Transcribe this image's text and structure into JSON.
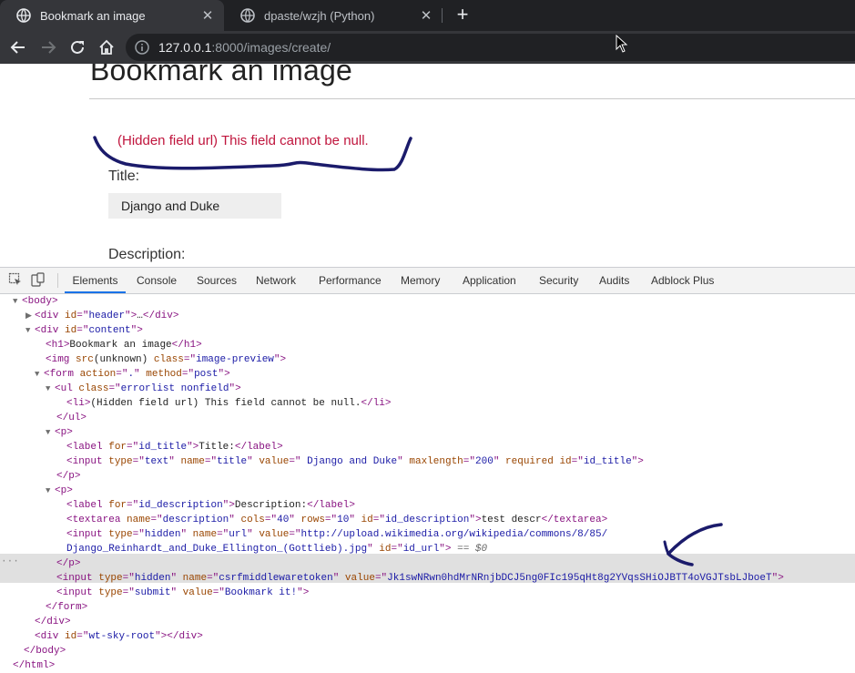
{
  "browser": {
    "tabs": [
      {
        "title": "Bookmark an image",
        "active": true
      },
      {
        "title": "dpaste/wzjh (Python)",
        "active": false
      }
    ],
    "url_host": "127.0.0.1",
    "url_rest": ":8000/images/create/"
  },
  "page": {
    "heading": "Bookmark an image",
    "error": "(Hidden field url) This field cannot be null.",
    "title_label": "Title:",
    "title_value": "Django and Duke",
    "description_label": "Description:"
  },
  "devtools": {
    "tabs": [
      "Elements",
      "Console",
      "Sources",
      "Network",
      "Performance",
      "Memory",
      "Application",
      "Security",
      "Audits",
      "Adblock Plus"
    ],
    "active_tab": "Elements",
    "tree": {
      "body_open": "body",
      "header": {
        "tag": "div",
        "attr": "id",
        "val": "header",
        "ellipsis": "…",
        "close": "/div"
      },
      "content_div": {
        "tag": "div",
        "attr": "id",
        "val": "content"
      },
      "h1": {
        "tag": "h1",
        "text": "Bookmark an image",
        "close": "/h1"
      },
      "img": {
        "tag": "img",
        "attr1": "src",
        "val1": "(unknown)",
        "attr2": "class",
        "val2": "image-preview"
      },
      "form": {
        "tag": "form",
        "attr1": "action",
        "val1": ".",
        "attr2": "method",
        "val2": "post"
      },
      "ul": {
        "tag": "ul",
        "attr": "class",
        "val": "errorlist nonfield"
      },
      "li": {
        "tag": "li",
        "text": "(Hidden field url) This field cannot be null.",
        "close": "/li"
      },
      "ul_close": "/ul",
      "p_tag": "p",
      "p_close": "/p",
      "label_title": {
        "tag": "label",
        "attr": "for",
        "val": "id_title",
        "text": "Title:",
        "close": "/label"
      },
      "input_title": {
        "tag": "input",
        "a1": "type",
        "v1": "text",
        "a2": "name",
        "v2": "title",
        "a3": "value",
        "v3": " Django and Duke",
        "a4": "maxlength",
        "v4": "200",
        "a5": "required",
        "a6": "id",
        "v6": "id_title"
      },
      "label_desc": {
        "tag": "label",
        "attr": "for",
        "val": "id_description",
        "text": "Description:",
        "close": "/label"
      },
      "textarea": {
        "tag": "textarea",
        "a1": "name",
        "v1": "description",
        "a2": "cols",
        "v2": "40",
        "a3": "rows",
        "v3": "10",
        "a4": "id",
        "v4": "id_description",
        "text": "test descr",
        "close": "/textarea"
      },
      "input_url": {
        "tag": "input",
        "a1": "type",
        "v1": "hidden",
        "a2": "name",
        "v2": "url",
        "a3": "value",
        "v3a": "http://upload.wikimedia.org/wikipedia/commons/8/85/",
        "v3b": "Django_Reinhardt_and_Duke_Ellington_(Gottlieb).jpg",
        "a4": "id",
        "v4": "id_url",
        "suffix": "== $0"
      },
      "input_csrf": {
        "tag": "input",
        "a1": "type",
        "v1": "hidden",
        "a2": "name",
        "v2": "csrfmiddlewaretoken",
        "a3": "value",
        "v3": "Jk1swNRwn0hdMrNRnjbDCJ5ng0FIc195qHt8g2YVqsSHiOJBTT4oVGJTsbLJboeT"
      },
      "input_submit": {
        "tag": "input",
        "a1": "type",
        "v1": "submit",
        "a2": "value",
        "v2": "Bookmark it!"
      },
      "form_close": "/form",
      "div_close": "/div",
      "sky": {
        "tag": "div",
        "attr": "id",
        "val": "wt-sky-root",
        "close": "/div"
      },
      "body_close": "/body",
      "html_close": "/html"
    }
  },
  "colors": {
    "error": "#c0153d",
    "tag": "#881280",
    "attr_name": "#994500",
    "attr_value": "#1a1aa6",
    "annotation_ink": "#1b1b6b"
  }
}
